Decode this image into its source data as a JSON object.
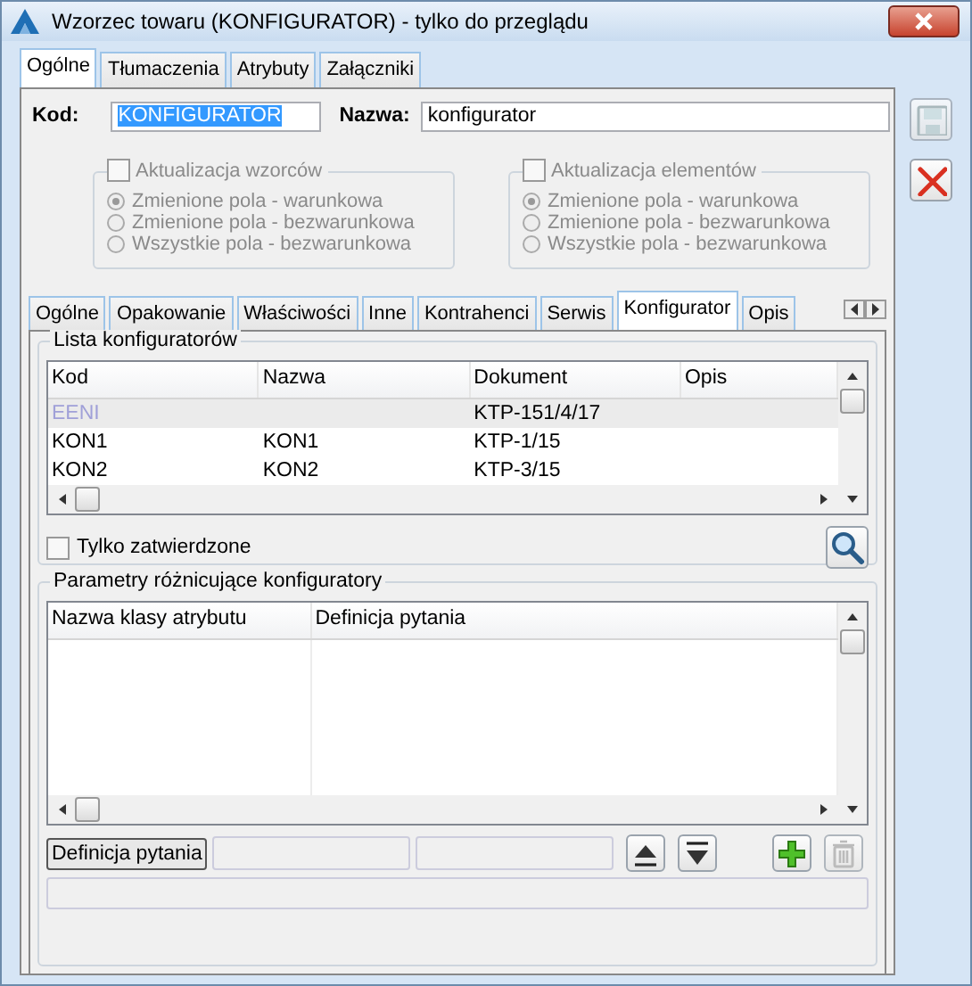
{
  "window": {
    "title": "Wzorzec towaru (KONFIGURATOR) - tylko do przeglądu"
  },
  "tabs": [
    {
      "label": "Ogólne",
      "selected": true
    },
    {
      "label": "Tłumaczenia",
      "selected": false
    },
    {
      "label": "Atrybuty",
      "selected": false
    },
    {
      "label": "Załączniki",
      "selected": false
    }
  ],
  "side_buttons": [
    {
      "kind": "save",
      "disabled": true
    },
    {
      "kind": "cancel",
      "disabled": false
    }
  ],
  "fields": [
    {
      "label": "Kod:",
      "value": "KONFIGURATOR",
      "highlighted": true
    },
    {
      "label": "Nazwa:",
      "value": "konfigurator",
      "highlighted": false
    }
  ],
  "option_groups": [
    {
      "label": "Aktualizacja wzorców",
      "checked": false,
      "disabled": true,
      "options": [
        {
          "label": "Zmienione pola - warunkowa",
          "selected": true
        },
        {
          "label": "Zmienione pola - bezwarunkowa",
          "selected": false
        },
        {
          "label": "Wszystkie pola - bezwarunkowa",
          "selected": false
        }
      ]
    },
    {
      "label": "Aktualizacja elementów",
      "checked": false,
      "disabled": true,
      "options": [
        {
          "label": "Zmienione pola - warunkowa",
          "selected": true
        },
        {
          "label": "Zmienione pola - bezwarunkowa",
          "selected": false
        },
        {
          "label": "Wszystkie pola - bezwarunkowa",
          "selected": false
        }
      ]
    }
  ],
  "inner_tabs": [
    {
      "label": "Ogólne",
      "selected": false
    },
    {
      "label": "Opakowanie",
      "selected": false
    },
    {
      "label": "Właściwości",
      "selected": false
    },
    {
      "label": "Inne",
      "selected": false
    },
    {
      "label": "Kontrahenci",
      "selected": false
    },
    {
      "label": "Serwis",
      "selected": false
    },
    {
      "label": "Konfigurator",
      "selected": true
    },
    {
      "label": "Opis",
      "selected": false
    }
  ],
  "configurator_list": {
    "title": "Lista konfiguratorów",
    "columns": [
      "Kod",
      "Nazwa",
      "Dokument",
      "Opis"
    ],
    "rows": [
      {
        "kod": "EENI",
        "dokument": "KTP-151/4/17",
        "selected": true,
        "inactive": true
      },
      {
        "kod": "KON1",
        "nazwa": "KON1",
        "dokument": "KTP-1/15",
        "selected": false,
        "inactive": false
      },
      {
        "kod": "KON2",
        "nazwa": "KON2",
        "dokument": "KTP-3/15",
        "selected": false,
        "inactive": false
      }
    ]
  },
  "only_approved": {
    "label": "Tylko zatwierdzone",
    "checked": false
  },
  "parameters": {
    "title": "Parametry różnicujące konfiguratory",
    "columns": [
      "Nazwa klasy atrybutu",
      "Definicja pytania"
    ],
    "definition_button": "Definicja pytania",
    "buttons": [
      {
        "kind": "move-up",
        "disabled": false
      },
      {
        "kind": "move-down",
        "disabled": false
      },
      {
        "kind": "add",
        "disabled": false
      },
      {
        "kind": "delete",
        "disabled": true
      }
    ]
  }
}
